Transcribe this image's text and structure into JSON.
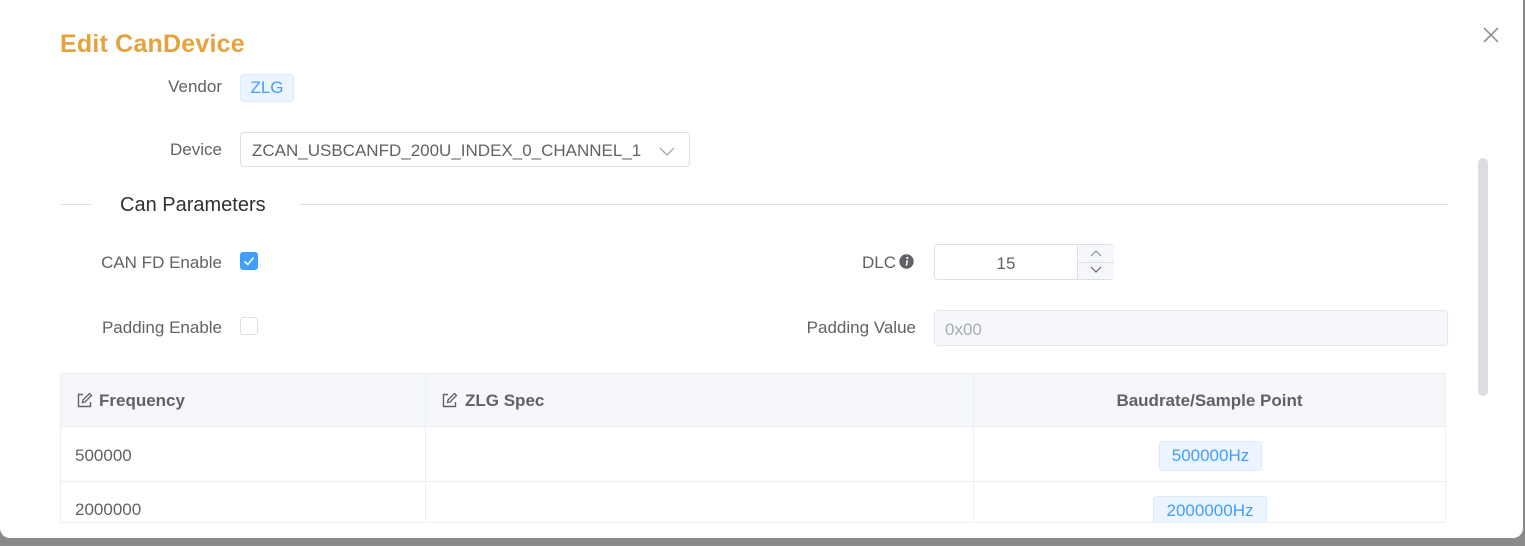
{
  "dialog": {
    "title": "Edit CanDevice",
    "close_icon": "close-icon"
  },
  "form": {
    "vendor_label": "Vendor",
    "vendor_value": "ZLG",
    "device_label": "Device",
    "device_value": "ZCAN_USBCANFD_200U_INDEX_0_CHANNEL_1"
  },
  "can_params": {
    "section_title": "Can Parameters",
    "canfd_label": "CAN FD Enable",
    "canfd_checked": true,
    "dlc_label": "DLC",
    "dlc_value": "15",
    "padding_label": "Padding Enable",
    "padding_checked": false,
    "padding_value_label": "Padding Value",
    "padding_value_placeholder": "0x00"
  },
  "table": {
    "columns": [
      "Frequency",
      "ZLG Spec",
      "Baudrate/Sample Point"
    ],
    "rows": [
      {
        "frequency": "500000",
        "zlg_spec": "",
        "baudrate": "500000Hz"
      },
      {
        "frequency": "2000000",
        "zlg_spec": "",
        "baudrate": "2000000Hz"
      }
    ]
  },
  "colors": {
    "title": "#e6a23c",
    "primary": "#409eff",
    "tag_bg": "#ecf5ff"
  }
}
